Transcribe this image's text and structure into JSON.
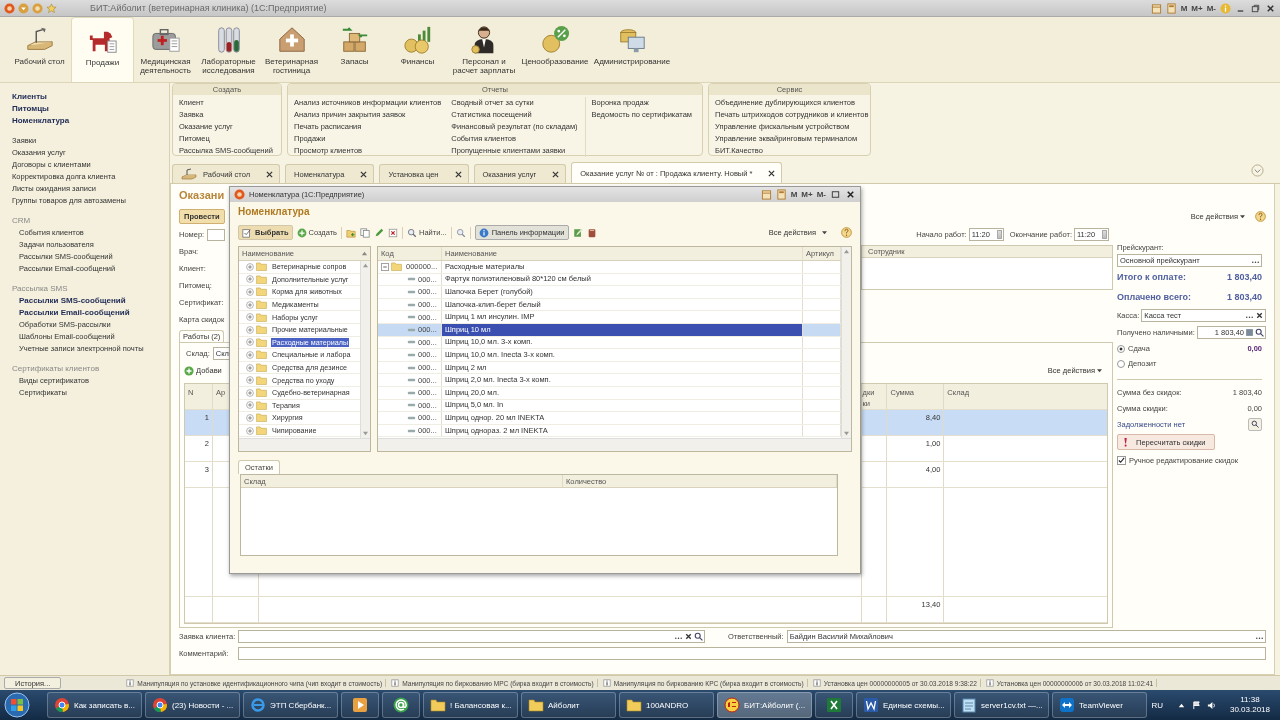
{
  "window": {
    "title": "БИТ:Айболит (ветеринарная клиника) (1С:Предприятие)",
    "memory_buttons": [
      "M",
      "M+",
      "M-"
    ]
  },
  "sections": [
    {
      "label": "Рабочий стол",
      "kind": "desk",
      "selected": false
    },
    {
      "label": "Продажи",
      "kind": "dog",
      "selected": true
    },
    {
      "label": "Медицинская деятельность",
      "kind": "medkit",
      "selected": false
    },
    {
      "label": "Лабораторные исследования",
      "kind": "tubes",
      "selected": false
    },
    {
      "label": "Ветеринарная гостиница",
      "kind": "house",
      "selected": false
    },
    {
      "label": "Запасы",
      "kind": "boxes",
      "selected": false
    },
    {
      "label": "Финансы",
      "kind": "coins",
      "selected": false
    },
    {
      "label": "Персонал и расчет зарплаты",
      "kind": "person",
      "selected": false
    },
    {
      "label": "Ценообразование",
      "kind": "percent",
      "selected": false
    },
    {
      "label": "Администрирование",
      "kind": "computer",
      "selected": false
    }
  ],
  "sidebar": {
    "groups": [
      {
        "items": [
          {
            "label": "Клиенты",
            "bold": true
          },
          {
            "label": "Питомцы",
            "bold": true
          },
          {
            "label": "Номенклатура",
            "bold": true
          }
        ]
      },
      {
        "items": [
          {
            "label": "Заявки",
            "bold": false
          },
          {
            "label": "Оказания услуг",
            "bold": false
          },
          {
            "label": "Договоры с клиентами",
            "bold": false
          },
          {
            "label": "Корректировка долга клиента",
            "bold": false
          },
          {
            "label": "Листы ожидания записи",
            "bold": false
          },
          {
            "label": "Группы товаров для автозамены",
            "bold": false
          }
        ]
      },
      {
        "title": "CRM",
        "items": [
          {
            "label": "События клиентов",
            "bold": false
          },
          {
            "label": "Задачи пользователя",
            "bold": false
          },
          {
            "label": "Рассылки SMS-сообщений",
            "bold": false
          },
          {
            "label": "Рассылки Email-сообщений",
            "bold": false
          }
        ]
      },
      {
        "title": "Рассылка SMS",
        "items": [
          {
            "label": "Рассылки SMS-сообщений",
            "bold": true
          },
          {
            "label": "Рассылки Email-сообщений",
            "bold": true
          },
          {
            "label": "Обработки SMS-рассылки",
            "bold": false
          },
          {
            "label": "Шаблоны Email-сообщений",
            "bold": false
          },
          {
            "label": "Учетные записи электронной почты",
            "bold": false
          }
        ]
      },
      {
        "title": "Сертификаты клиентов",
        "items": [
          {
            "label": "Виды сертификатов",
            "bold": false
          },
          {
            "label": "Сертификаты",
            "bold": false
          }
        ]
      }
    ]
  },
  "action_panel": {
    "groups": [
      {
        "title": "Создать",
        "columns": [
          [
            "Клиент",
            "Заявка",
            "Оказание услуг",
            "Питомец",
            "Рассылка SMS-сообщений"
          ]
        ]
      },
      {
        "title": "Отчеты",
        "columns": [
          [
            "Анализ источников информации клиентов",
            "Анализ причин закрытия заявок",
            "Печать расписания",
            "Продажи",
            "Просмотр клиентов"
          ],
          [
            "Сводный отчет за сутки",
            "Статистика посещений",
            "Финансовый результат (по складам)",
            "События клиентов",
            "Пропущенные клиентами заявки"
          ],
          [
            "Воронка продаж",
            "Ведомость по сертификатам"
          ]
        ]
      },
      {
        "title": "Сервис",
        "columns": [
          [
            "Объединение дублирующихся клиентов",
            "Печать штрихкодов сотрудников и клиентов",
            "Управление фискальным устройством",
            "Управление эквайринговым терминалом",
            "БИТ.Качество"
          ]
        ]
      }
    ]
  },
  "tabs": [
    {
      "label": "Рабочий стол",
      "kind": "desk",
      "selected": false
    },
    {
      "label": "Номенклатура",
      "kind": "plain",
      "selected": false
    },
    {
      "label": "Установка цен",
      "kind": "plain",
      "selected": false
    },
    {
      "label": "Оказания услуг",
      "kind": "plain",
      "selected": false
    },
    {
      "label": "Оказание услуг №  от : Продажа клиенту. Новый *",
      "kind": "plain",
      "selected": true
    }
  ],
  "form": {
    "title": "Оказани",
    "post_button": "Провести",
    "all_actions": "Все действия",
    "fields": [
      {
        "label": "Номер:",
        "kind": "field"
      },
      {
        "label": "Врач:",
        "kind": "text"
      },
      {
        "label": "Клиент:",
        "kind": "text"
      },
      {
        "label": "Питомец:",
        "kind": "text"
      },
      {
        "label": "Сертификат:",
        "kind": "text"
      },
      {
        "label": "Карта скидок",
        "kind": "text"
      }
    ],
    "work_start": {
      "label": "Начало работ:",
      "value": "11:20"
    },
    "work_end": {
      "label": "Окончание работ:",
      "value": "11:20"
    },
    "staff_table": {
      "columns": [
        "Сотрудник"
      ]
    },
    "works_tab": {
      "label": "Работы (2)",
      "selected": true
    },
    "warehouse": {
      "label": "Склад:",
      "value": "Скл"
    },
    "add_button": "Добави",
    "table_actions": "Все действия",
    "items_table": {
      "columns": [
        {
          "label": "N"
        },
        {
          "label": "Ар"
        },
        {
          "label": "дки",
          "sublabel": "ки"
        },
        {
          "label": "Сумма"
        },
        {
          "label": "Склад"
        }
      ],
      "rows": [
        {
          "n": "1",
          "sum": "8,40",
          "selected": true
        },
        {
          "n": "2",
          "sum": "1,00",
          "selected": false
        },
        {
          "n": "3",
          "sum": "4,00",
          "selected": false
        }
      ],
      "total": "13,40"
    },
    "summary": {
      "price_list": {
        "label": "Прейскурант:",
        "value": "Основной прейскурант"
      },
      "total_due": {
        "label": "Итого к оплате:",
        "value": "1 803,40"
      },
      "paid": {
        "label": "Оплачено всего:",
        "value": "1 803,40"
      },
      "cashbox": {
        "label": "Касса:",
        "value": "Касса тест"
      },
      "cash_received": {
        "label": "Получено наличными:",
        "value": "1 803,40"
      },
      "options": [
        {
          "label": "Сдача",
          "selected": true,
          "value": "0,00"
        },
        {
          "label": "Депозит",
          "selected": false
        }
      ],
      "sum_no_discount": {
        "label": "Сумма без скидок:",
        "value": "1 803,40"
      },
      "discount": {
        "label": "Сумма скидки:",
        "value": "0,00"
      },
      "debt_link": "Задолженности нет",
      "recalc_button": "Пересчитать скидки",
      "manual_discount": {
        "label": "Ручное редактирование скидок",
        "checked": true
      }
    },
    "request": {
      "label": "Заявка клиента:"
    },
    "responsible": {
      "label": "Ответственный:",
      "value": "Байдин Василий Михайлович"
    },
    "comment": {
      "label": "Комментарий:"
    }
  },
  "dialog": {
    "title": "Номенклатура (1С:Предприятие)",
    "memory_buttons": [
      "M",
      "M+",
      "M-"
    ],
    "heading": "Номенклатура",
    "toolbar": {
      "select": "Выбрать",
      "create": "Создать",
      "find": "Найти...",
      "info_panel": {
        "label": "Панель информации",
        "on": true
      },
      "all_actions": "Все действия"
    },
    "groups": {
      "column": "Наименование",
      "items": [
        {
          "label": "Ветеринарные сопров",
          "selected": false,
          "expanded": false
        },
        {
          "label": "Дополнительные услуг",
          "selected": false,
          "expanded": false
        },
        {
          "label": "Корма для животных",
          "selected": false,
          "expanded": false
        },
        {
          "label": "Медикаменты",
          "selected": false,
          "expanded": false
        },
        {
          "label": "Наборы услуг",
          "selected": false,
          "expanded": false
        },
        {
          "label": "Прочие материальные",
          "selected": false,
          "expanded": false
        },
        {
          "label": "Расходные материалы",
          "selected": true,
          "expanded": false
        },
        {
          "label": "Специальные и лабора",
          "selected": false,
          "expanded": false
        },
        {
          "label": "Средства для дезинсе",
          "selected": false,
          "expanded": false
        },
        {
          "label": "Средства по уходу",
          "selected": false,
          "expanded": false
        },
        {
          "label": "Судебно-ветеринарная",
          "selected": false,
          "expanded": false
        },
        {
          "label": "Терапия",
          "selected": false,
          "expanded": false
        },
        {
          "label": "Хирургия",
          "selected": false,
          "expanded": false
        },
        {
          "label": "Чипирование",
          "selected": false,
          "expanded": false
        }
      ]
    },
    "list": {
      "columns": [
        "Код",
        "Наименование",
        "Артикул"
      ],
      "rows": [
        {
          "kind": "group",
          "code": "000000...",
          "name": "Расходные материалы",
          "selected": false,
          "expanded": true
        },
        {
          "kind": "item",
          "code": "000...",
          "name": "Фартук полиэтиленовый 80*120 см белый",
          "selected": false
        },
        {
          "kind": "item",
          "code": "000...",
          "name": "Шапочка Берет (голубой)",
          "selected": false
        },
        {
          "kind": "item",
          "code": "000...",
          "name": "Шапочка-клип-берет белый",
          "selected": false
        },
        {
          "kind": "item",
          "code": "000...",
          "name": "Шприц 1 мл инсулин. IMP",
          "selected": false
        },
        {
          "kind": "item",
          "code": "000...",
          "name": "Шприц 10 мл",
          "selected": true
        },
        {
          "kind": "item",
          "code": "000...",
          "name": "Шприц 10,0 мл. 3-х комп.",
          "selected": false
        },
        {
          "kind": "item",
          "code": "000...",
          "name": "Шприц 10,0 мл. Inecta 3-х комп.",
          "selected": false
        },
        {
          "kind": "item",
          "code": "000...",
          "name": "Шприц 2 мл",
          "selected": false
        },
        {
          "kind": "item",
          "code": "000...",
          "name": "Шприц 2,0 мл. Inecta 3-х комп.",
          "selected": false
        },
        {
          "kind": "item",
          "code": "000...",
          "name": "Шприц 20,0 мл.",
          "selected": false
        },
        {
          "kind": "item",
          "code": "000...",
          "name": "Шприц 5,0 мл. In",
          "selected": false
        },
        {
          "kind": "item",
          "code": "000...",
          "name": "Шприц однор. 20 мл INEKTA",
          "selected": false
        },
        {
          "kind": "item",
          "code": "000...",
          "name": "Шприц однораз. 2 мл INEKTA",
          "selected": false
        }
      ]
    },
    "balance_tab": "Остатки",
    "balance_table": {
      "columns": [
        "Склад",
        "Количество"
      ]
    }
  },
  "status": {
    "history_button": "История...",
    "messages": [
      "Манипуляция по установке идентификационного чипа (чип входит в стоимость)",
      "Манипуляция по биркованию МРС (бирка входит в стоимость)",
      "Манипуляция по биркованию КРС (бирка входит в стоимость)",
      "Установка цен 00000000005 от 30.03.2018 9:38:22",
      "Установка цен 00000000006 от 30.03.2018 11:02:41"
    ]
  },
  "taskbar": {
    "items": [
      {
        "kind": "chrome",
        "label": "Как записать в...",
        "selected": false
      },
      {
        "kind": "chrome",
        "label": "(23) Новости - ...",
        "selected": false
      },
      {
        "kind": "ie",
        "label": "ЭТП Сбербанк...",
        "selected": false
      },
      {
        "kind": "media",
        "selected": false
      },
      {
        "kind": "mail",
        "selected": false
      },
      {
        "kind": "folder",
        "label": "! Балансовая к...",
        "selected": false
      },
      {
        "kind": "folder",
        "label": "Айболит",
        "selected": false
      },
      {
        "kind": "folder",
        "label": "100ANDRO",
        "selected": false
      },
      {
        "kind": "onec",
        "label": "БИТ:Айболит (...",
        "selected": true
      },
      {
        "kind": "excel",
        "selected": false
      },
      {
        "kind": "word",
        "label": "Единые схемы...",
        "selected": false
      },
      {
        "kind": "notepad",
        "label": "server1cv.txt —...",
        "selected": false
      },
      {
        "kind": "teamviewer",
        "label": "TeamViewer",
        "selected": false
      }
    ],
    "language": "RU",
    "time": "11:38",
    "date": "30.03.2018"
  }
}
